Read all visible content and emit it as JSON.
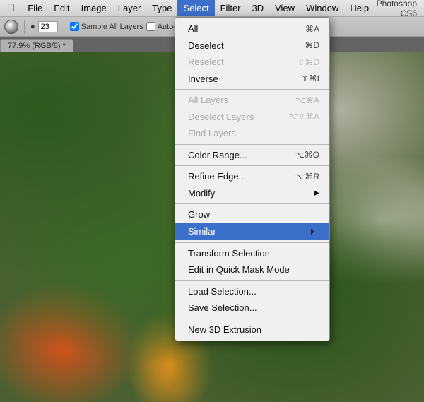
{
  "app": {
    "title": "Photoshop CS6"
  },
  "menubar": {
    "items": [
      {
        "label": "Apple",
        "icon": true
      },
      {
        "label": "File"
      },
      {
        "label": "Edit"
      },
      {
        "label": "Image"
      },
      {
        "label": "Layer"
      },
      {
        "label": "Type"
      },
      {
        "label": "Select",
        "active": true
      },
      {
        "label": "Filter"
      },
      {
        "label": "3D"
      },
      {
        "label": "View"
      },
      {
        "label": "Window"
      },
      {
        "label": "Help"
      }
    ]
  },
  "toolbar": {
    "size_label": "23",
    "sample_all_label": "Sample All Layers",
    "auto_enhance_label": "Auto-Enhance"
  },
  "tab": {
    "label": "77.9% (RGB/8)",
    "symbol": "*"
  },
  "select_menu": {
    "items": [
      {
        "label": "All",
        "shortcut": "⌘A",
        "disabled": false,
        "separator_after": false
      },
      {
        "label": "Deselect",
        "shortcut": "⌘D",
        "disabled": false
      },
      {
        "label": "Reselect",
        "shortcut": "⇧⌘D",
        "disabled": true
      },
      {
        "label": "Inverse",
        "shortcut": "⇧⌘I",
        "disabled": false,
        "separator_after": true
      },
      {
        "label": "All Layers",
        "shortcut": "⌥⌘A",
        "disabled": true
      },
      {
        "label": "Deselect Layers",
        "shortcut": "⌥⇧⌘A",
        "disabled": true
      },
      {
        "label": "Find Layers",
        "shortcut": "",
        "disabled": true,
        "separator_after": true
      },
      {
        "label": "Color Range...",
        "shortcut": "⌥⌘O",
        "disabled": false,
        "separator_after": true
      },
      {
        "label": "Refine Edge...",
        "shortcut": "⌥⌘R",
        "disabled": false
      },
      {
        "label": "Modify",
        "shortcut": "▶",
        "disabled": false,
        "separator_after": true
      },
      {
        "label": "Grow",
        "shortcut": "",
        "disabled": false
      },
      {
        "label": "Similar",
        "shortcut": "",
        "disabled": false,
        "highlighted": true,
        "separator_after": true
      },
      {
        "label": "Transform Selection",
        "shortcut": "",
        "disabled": false
      },
      {
        "label": "Edit in Quick Mask Mode",
        "shortcut": "",
        "disabled": false,
        "separator_after": true
      },
      {
        "label": "Load Selection...",
        "shortcut": "",
        "disabled": false
      },
      {
        "label": "Save Selection...",
        "shortcut": "",
        "disabled": false,
        "separator_after": true
      },
      {
        "label": "New 3D Extrusion",
        "shortcut": "",
        "disabled": false
      }
    ]
  }
}
